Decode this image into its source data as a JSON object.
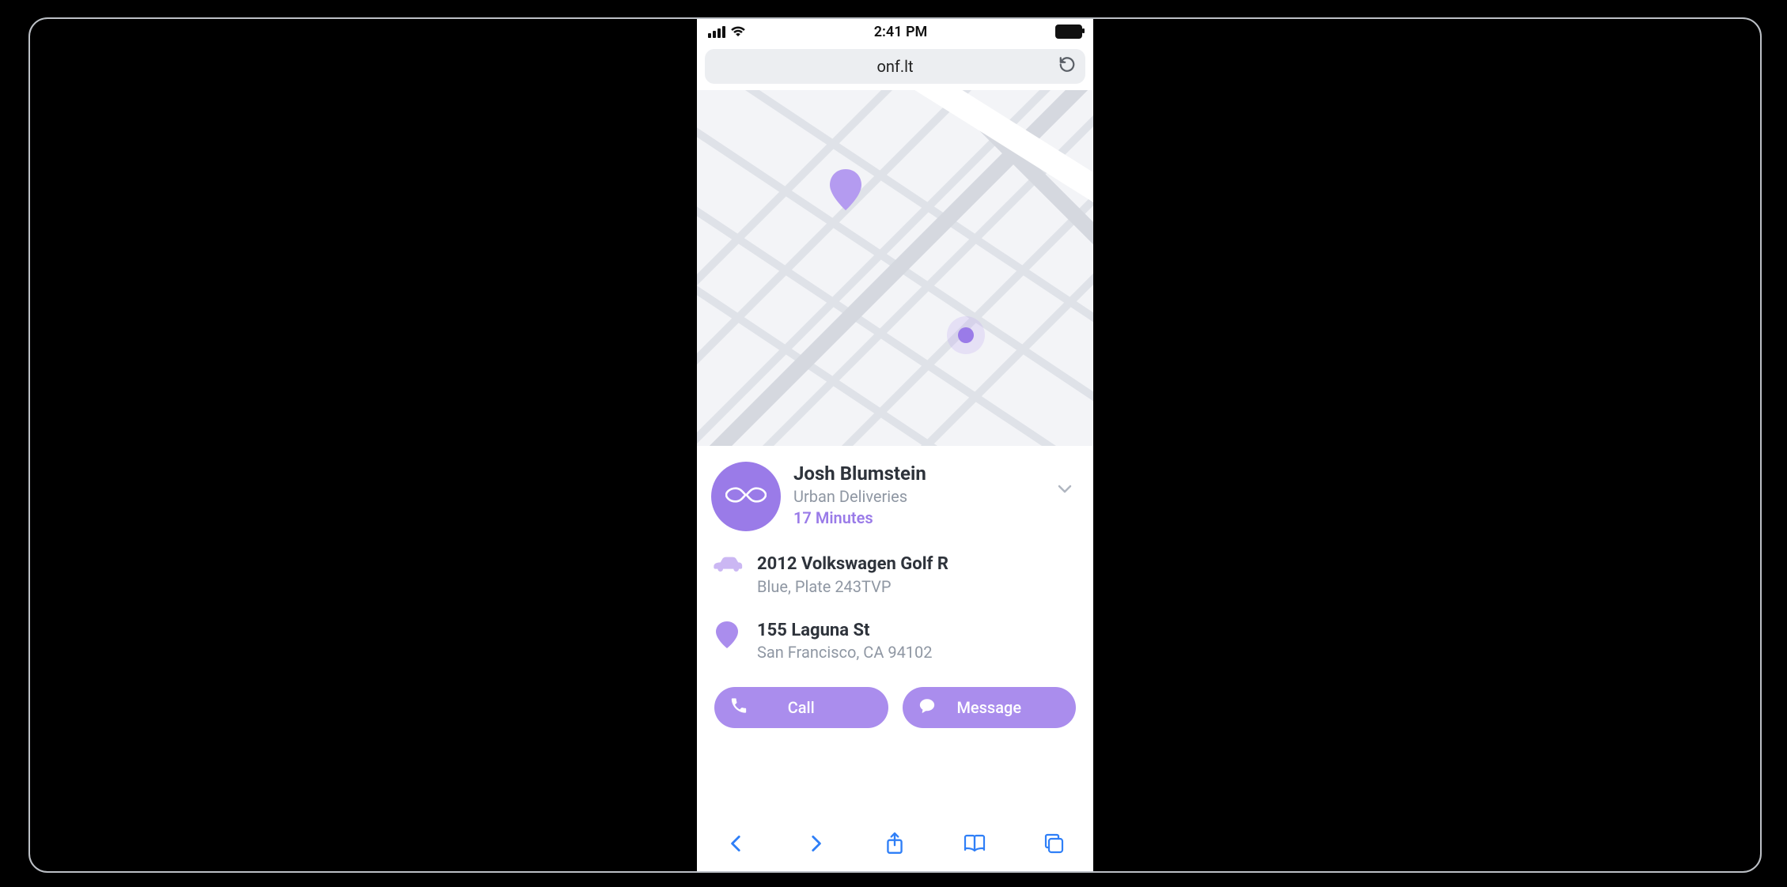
{
  "statusbar": {
    "time": "2:41 PM"
  },
  "browser": {
    "url": "onf.lt",
    "toolbar_icons": [
      "back",
      "forward",
      "share",
      "bookmarks",
      "tabs"
    ]
  },
  "map": {
    "pin_icon": "map-pin-icon",
    "driver_dot_icon": "driver-location-dot"
  },
  "driver": {
    "name": "Josh Blumstein",
    "company": "Urban Deliveries",
    "eta": "17 Minutes",
    "avatar_icon": "infinity-icon"
  },
  "vehicle": {
    "title": "2012 Volkswagen Golf R",
    "sub": "Blue, Plate 243TVP",
    "icon": "car-icon"
  },
  "destination": {
    "title": "155 Laguna St",
    "sub": "San Francisco, CA 94102",
    "icon": "pin-icon"
  },
  "actions": {
    "call": "Call",
    "message": "Message"
  },
  "colors": {
    "accent": "#9a7be8",
    "pill": "#aa8ded",
    "muted": "#8f97a3",
    "ios_blue": "#2f7ff7"
  }
}
